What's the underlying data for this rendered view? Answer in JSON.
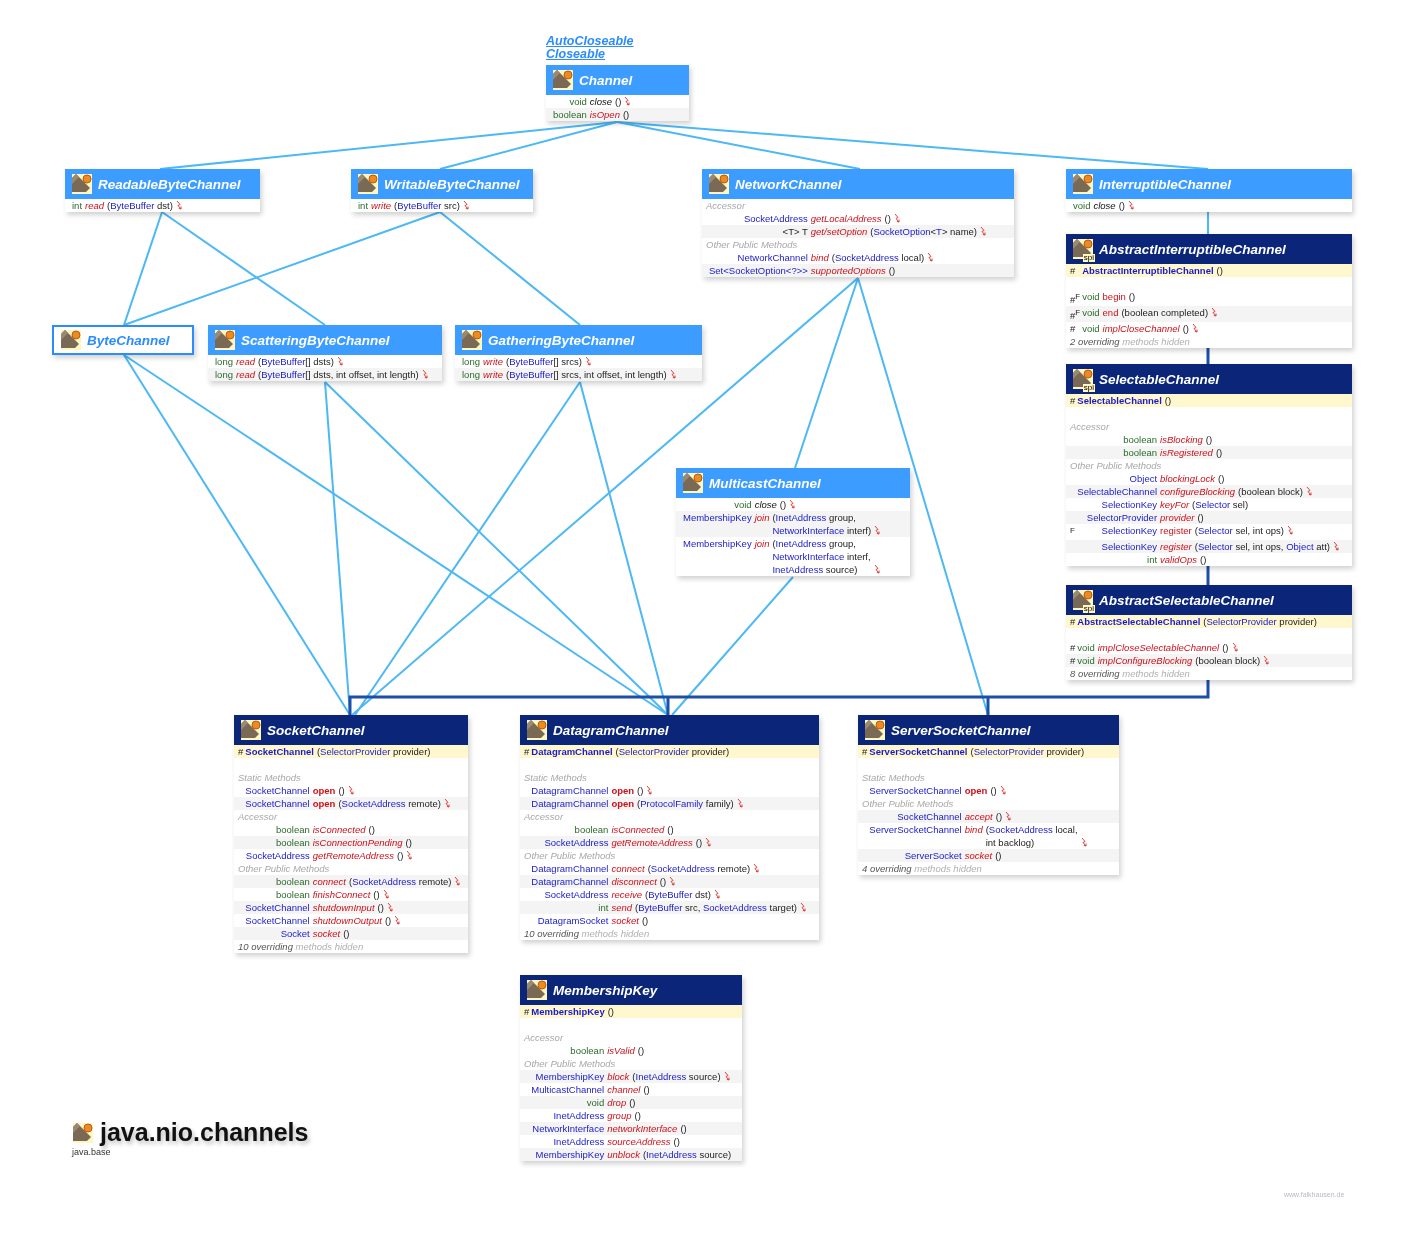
{
  "package": {
    "name": "java.nio.channels",
    "module": "java.base"
  },
  "credit": "www.falkhausen.de",
  "classes": [
    {
      "name": "Channel",
      "kind": "interface",
      "supers": [
        "AutoCloseable",
        "Closeable"
      ],
      "members": [
        {
          "kind": "inherited",
          "type": "void",
          "name": "close",
          "params": [
            "()"
          ],
          "throws": true
        },
        {
          "kind": "abstract",
          "type": "boolean",
          "name": "isOpen",
          "params": [
            "()"
          ],
          "throws": false
        }
      ]
    },
    {
      "name": "ReadableByteChannel",
      "kind": "interface",
      "members": [
        {
          "kind": "abstract",
          "type": "int",
          "name": "read",
          "params": [
            "(ByteBuffer dst)"
          ],
          "throws": true
        }
      ]
    },
    {
      "name": "WritableByteChannel",
      "kind": "interface",
      "members": [
        {
          "kind": "abstract",
          "type": "int",
          "name": "write",
          "params": [
            "(ByteBuffer src)"
          ],
          "throws": true
        }
      ]
    },
    {
      "name": "NetworkChannel",
      "kind": "interface",
      "members": [
        {
          "kind": "section",
          "text": "Accessor"
        },
        {
          "kind": "abstract",
          "type": "SocketAddress",
          "name": "getLocalAddress",
          "params": [
            "()"
          ],
          "throws": true
        },
        {
          "kind": "abstract",
          "type": "<T> T",
          "name": "get/setOption",
          "params": [
            "(SocketOption<T> name)"
          ],
          "throws": true
        },
        {
          "kind": "section",
          "text": "Other Public Methods"
        },
        {
          "kind": "abstract",
          "type": "NetworkChannel",
          "name": "bind",
          "params": [
            "(SocketAddress local)"
          ],
          "throws": true
        },
        {
          "kind": "abstract",
          "type": "Set<SocketOption<?>>",
          "name": "supportedOptions",
          "params": [
            "()"
          ],
          "throws": false
        }
      ]
    },
    {
      "name": "InterruptibleChannel",
      "kind": "interface",
      "members": [
        {
          "kind": "inherited",
          "type": "void",
          "name": "close",
          "params": [
            "()"
          ],
          "throws": true
        }
      ]
    },
    {
      "name": "ByteChannel",
      "kind": "collapsed"
    },
    {
      "name": "ScatteringByteChannel",
      "kind": "interface",
      "members": [
        {
          "kind": "abstract",
          "type": "long",
          "name": "read",
          "params": [
            "(ByteBuffer[] dsts)"
          ],
          "throws": true
        },
        {
          "kind": "abstract",
          "type": "long",
          "name": "read",
          "params": [
            "(ByteBuffer[] dsts, int offset, int length)"
          ],
          "throws": true
        }
      ]
    },
    {
      "name": "GatheringByteChannel",
      "kind": "interface",
      "members": [
        {
          "kind": "abstract",
          "type": "long",
          "name": "write",
          "params": [
            "(ByteBuffer[] srcs)"
          ],
          "throws": true
        },
        {
          "kind": "abstract",
          "type": "long",
          "name": "write",
          "params": [
            "(ByteBuffer[] srcs, int offset, int length)"
          ],
          "throws": true
        }
      ]
    },
    {
      "name": "AbstractInterruptibleChannel",
      "kind": "class",
      "badge": "spi",
      "members": [
        {
          "kind": "ctor",
          "mods": "#",
          "name": "AbstractInterruptibleChannel",
          "params": [
            "()"
          ]
        },
        {
          "kind": "concrete",
          "mods": "#$^{F}$",
          "type": "void",
          "name": "begin",
          "params": [
            "()"
          ],
          "throws": false
        },
        {
          "kind": "concrete",
          "mods": "#$^{F}$",
          "type": "void",
          "name": "end",
          "params": [
            "(boolean completed)"
          ],
          "throws": true
        },
        {
          "kind": "abstract",
          "mods": "#",
          "type": "void",
          "name": "implCloseChannel",
          "params": [
            "()"
          ],
          "throws": true
        },
        {
          "kind": "footer",
          "text": "2 overriding",
          "rest": "methods hidden"
        }
      ]
    },
    {
      "name": "MulticastChannel",
      "kind": "interface",
      "members": [
        {
          "kind": "inherited",
          "type": "void",
          "name": "close",
          "params": [
            "()"
          ],
          "throws": true
        },
        {
          "kind": "abstract",
          "type": "MembershipKey",
          "name": "join",
          "params": [
            "(InetAddress group,",
            "NetworkInterface interf)"
          ],
          "throws": true
        },
        {
          "kind": "abstract",
          "type": "MembershipKey",
          "name": "join",
          "params": [
            "(InetAddress group,",
            "NetworkInterface interf,",
            "InetAddress source)"
          ],
          "throws": true
        }
      ]
    },
    {
      "name": "SelectableChannel",
      "kind": "class",
      "badge": "spi",
      "members": [
        {
          "kind": "ctor",
          "mods": "#",
          "name": "SelectableChannel",
          "params": [
            "()"
          ]
        },
        {
          "kind": "section",
          "text": "Accessor"
        },
        {
          "kind": "abstract",
          "type": "boolean",
          "name": "isBlocking",
          "params": [
            "()"
          ],
          "throws": false
        },
        {
          "kind": "abstract",
          "type": "boolean",
          "name": "isRegistered",
          "params": [
            "()"
          ],
          "throws": false
        },
        {
          "kind": "section",
          "text": "Other Public Methods"
        },
        {
          "kind": "abstract",
          "type": "Object",
          "name": "blockingLock",
          "params": [
            "()"
          ],
          "throws": false
        },
        {
          "kind": "abstract",
          "type": "SelectableChannel",
          "name": "configureBlocking",
          "params": [
            "(boolean block)"
          ],
          "throws": true
        },
        {
          "kind": "abstract",
          "type": "SelectionKey",
          "name": "keyFor",
          "params": [
            "(Selector sel)"
          ],
          "throws": false
        },
        {
          "kind": "abstract",
          "type": "SelectorProvider",
          "name": "provider",
          "params": [
            "()"
          ],
          "throws": false
        },
        {
          "kind": "concrete",
          "mods": "$^{F}$",
          "type": "SelectionKey",
          "name": "register",
          "params": [
            "(Selector sel, int ops)"
          ],
          "throws": true
        },
        {
          "kind": "abstract",
          "type": "SelectionKey",
          "name": "register",
          "params": [
            "(Selector sel, int ops, Object att)"
          ],
          "throws": true
        },
        {
          "kind": "abstract",
          "type": "int",
          "name": "validOps",
          "params": [
            "()"
          ],
          "throws": false
        }
      ]
    },
    {
      "name": "AbstractSelectableChannel",
      "kind": "class",
      "badge": "spi",
      "members": [
        {
          "kind": "ctor",
          "mods": "#",
          "name": "AbstractSelectableChannel",
          "params": [
            "(SelectorProvider provider)"
          ]
        },
        {
          "kind": "abstract",
          "mods": "#",
          "type": "void",
          "name": "implCloseSelectableChannel",
          "params": [
            "()"
          ],
          "throws": true
        },
        {
          "kind": "abstract",
          "mods": "#",
          "type": "void",
          "name": "implConfigureBlocking",
          "params": [
            "(boolean block)"
          ],
          "throws": true
        },
        {
          "kind": "footer",
          "text": "8 overriding",
          "rest": "methods hidden"
        }
      ]
    },
    {
      "name": "SocketChannel",
      "kind": "class",
      "members": [
        {
          "kind": "ctor",
          "mods": "#",
          "name": "SocketChannel",
          "params": [
            "(SelectorProvider provider)"
          ]
        },
        {
          "kind": "section",
          "text": "Static Methods"
        },
        {
          "kind": "static",
          "type": "SocketChannel",
          "name": "open",
          "params": [
            "()"
          ],
          "throws": true
        },
        {
          "kind": "static",
          "type": "SocketChannel",
          "name": "open",
          "params": [
            "(SocketAddress remote)"
          ],
          "throws": true
        },
        {
          "kind": "section",
          "text": "Accessor"
        },
        {
          "kind": "abstract",
          "type": "boolean",
          "name": "isConnected",
          "params": [
            "()"
          ],
          "throws": false
        },
        {
          "kind": "abstract",
          "type": "boolean",
          "name": "isConnectionPending",
          "params": [
            "()"
          ],
          "throws": false
        },
        {
          "kind": "abstract",
          "type": "SocketAddress",
          "name": "getRemoteAddress",
          "params": [
            "()"
          ],
          "throws": true
        },
        {
          "kind": "section",
          "text": "Other Public Methods"
        },
        {
          "kind": "abstract",
          "type": "boolean",
          "name": "connect",
          "params": [
            "(SocketAddress remote)"
          ],
          "throws": true
        },
        {
          "kind": "abstract",
          "type": "boolean",
          "name": "finishConnect",
          "params": [
            "()"
          ],
          "throws": true
        },
        {
          "kind": "abstract",
          "type": "SocketChannel",
          "name": "shutdownInput",
          "params": [
            "()"
          ],
          "throws": true
        },
        {
          "kind": "abstract",
          "type": "SocketChannel",
          "name": "shutdownOutput",
          "params": [
            "()"
          ],
          "throws": true
        },
        {
          "kind": "abstract",
          "type": "Socket",
          "name": "socket",
          "params": [
            "()"
          ],
          "throws": false
        },
        {
          "kind": "footer",
          "text": "10 overriding",
          "rest": "methods hidden"
        }
      ]
    },
    {
      "name": "DatagramChannel",
      "kind": "class",
      "members": [
        {
          "kind": "ctor",
          "mods": "#",
          "name": "DatagramChannel",
          "params": [
            "(SelectorProvider provider)"
          ]
        },
        {
          "kind": "section",
          "text": "Static Methods"
        },
        {
          "kind": "static",
          "type": "DatagramChannel",
          "name": "open",
          "params": [
            "()"
          ],
          "throws": true
        },
        {
          "kind": "static",
          "type": "DatagramChannel",
          "name": "open",
          "params": [
            "(ProtocolFamily family)"
          ],
          "throws": true
        },
        {
          "kind": "section",
          "text": "Accessor"
        },
        {
          "kind": "abstract",
          "type": "boolean",
          "name": "isConnected",
          "params": [
            "()"
          ],
          "throws": false
        },
        {
          "kind": "abstract",
          "type": "SocketAddress",
          "name": "getRemoteAddress",
          "params": [
            "()"
          ],
          "throws": true
        },
        {
          "kind": "section",
          "text": "Other Public Methods"
        },
        {
          "kind": "abstract",
          "type": "DatagramChannel",
          "name": "connect",
          "params": [
            "(SocketAddress remote)"
          ],
          "throws": true
        },
        {
          "kind": "abstract",
          "type": "DatagramChannel",
          "name": "disconnect",
          "params": [
            "()"
          ],
          "throws": true
        },
        {
          "kind": "abstract",
          "type": "SocketAddress",
          "name": "receive",
          "params": [
            "(ByteBuffer dst)"
          ],
          "throws": true
        },
        {
          "kind": "abstract",
          "type": "int",
          "name": "send",
          "params": [
            "(ByteBuffer src, SocketAddress target)"
          ],
          "throws": true
        },
        {
          "kind": "abstract",
          "type": "DatagramSocket",
          "name": "socket",
          "params": [
            "()"
          ],
          "throws": false
        },
        {
          "kind": "footer",
          "text": "10 overriding",
          "rest": "methods hidden"
        }
      ]
    },
    {
      "name": "ServerSocketChannel",
      "kind": "class",
      "members": [
        {
          "kind": "ctor",
          "mods": "#",
          "name": "ServerSocketChannel",
          "params": [
            "(SelectorProvider provider)"
          ]
        },
        {
          "kind": "section",
          "text": "Static Methods"
        },
        {
          "kind": "static",
          "type": "ServerSocketChannel",
          "name": "open",
          "params": [
            "()"
          ],
          "throws": true
        },
        {
          "kind": "section",
          "text": "Other Public Methods"
        },
        {
          "kind": "abstract",
          "type": "SocketChannel",
          "name": "accept",
          "params": [
            "()"
          ],
          "throws": true
        },
        {
          "kind": "abstract",
          "type": "ServerSocketChannel",
          "name": "bind",
          "params": [
            "(SocketAddress local,",
            "int backlog)"
          ],
          "throws": true
        },
        {
          "kind": "abstract",
          "type": "ServerSocket",
          "name": "socket",
          "params": [
            "()"
          ],
          "throws": false
        },
        {
          "kind": "footer",
          "text": "4 overriding",
          "rest": "methods hidden"
        }
      ]
    },
    {
      "name": "MembershipKey",
      "kind": "class",
      "members": [
        {
          "kind": "ctor",
          "mods": "#",
          "name": "MembershipKey",
          "params": [
            "()"
          ]
        },
        {
          "kind": "section",
          "text": "Accessor"
        },
        {
          "kind": "abstract",
          "type": "boolean",
          "name": "isValid",
          "params": [
            "()"
          ],
          "throws": false
        },
        {
          "kind": "section",
          "text": "Other Public Methods"
        },
        {
          "kind": "abstract",
          "type": "MembershipKey",
          "name": "block",
          "params": [
            "(InetAddress source)"
          ],
          "throws": true
        },
        {
          "kind": "abstract",
          "type": "MulticastChannel",
          "name": "channel",
          "params": [
            "()"
          ],
          "throws": false
        },
        {
          "kind": "abstract",
          "type": "void",
          "name": "drop",
          "params": [
            "()"
          ],
          "throws": false
        },
        {
          "kind": "abstract",
          "type": "InetAddress",
          "name": "group",
          "params": [
            "()"
          ],
          "throws": false
        },
        {
          "kind": "abstract",
          "type": "NetworkInterface",
          "name": "networkInterface",
          "params": [
            "()"
          ],
          "throws": false
        },
        {
          "kind": "abstract",
          "type": "InetAddress",
          "name": "sourceAddress",
          "params": [
            "()"
          ],
          "throws": false
        },
        {
          "kind": "abstract",
          "type": "MembershipKey",
          "name": "unblock",
          "params": [
            "(InetAddress source)"
          ],
          "throws": false
        }
      ]
    }
  ]
}
